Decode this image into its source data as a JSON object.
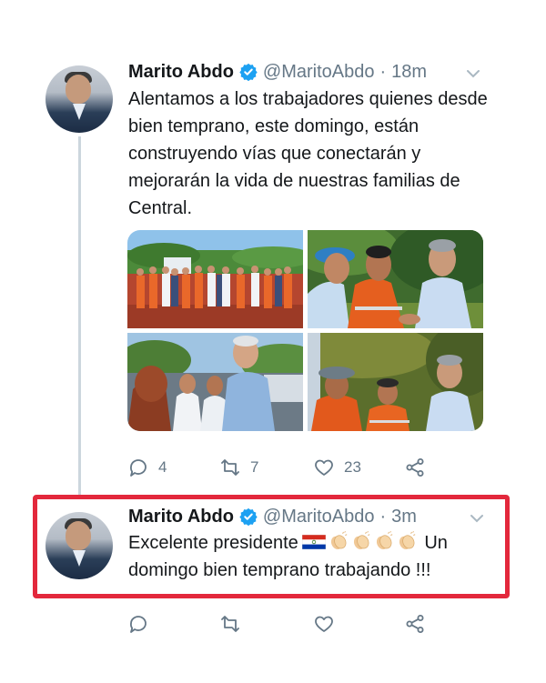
{
  "tweet1": {
    "name": "Marito Abdo",
    "handle": "@MaritoAbdo",
    "separator": "·",
    "time": "18m",
    "text": "Alentamos a los trabajadores quienes desde bien temprano, este domingo, están construyendo vías que conectarán y mejorarán la vida de nuestras familias de Central.",
    "actions": {
      "replies": "4",
      "retweets": "7",
      "likes": "23"
    }
  },
  "tweet2": {
    "name": "Marito Abdo",
    "handle": "@MaritoAbdo",
    "separator": "·",
    "time": "3m",
    "text_before": "Excelente presidente",
    "text_after": "Un domingo bien temprano trabajando !!!",
    "emoji": [
      "paraguay-flag",
      "clapping-hands",
      "clapping-hands",
      "clapping-hands",
      "clapping-hands"
    ]
  },
  "colors": {
    "text": "#14171a",
    "secondary": "#657786",
    "verified": "#1da1f2",
    "highlight": "#e3283c",
    "thread_line": "#ccd6dd"
  }
}
